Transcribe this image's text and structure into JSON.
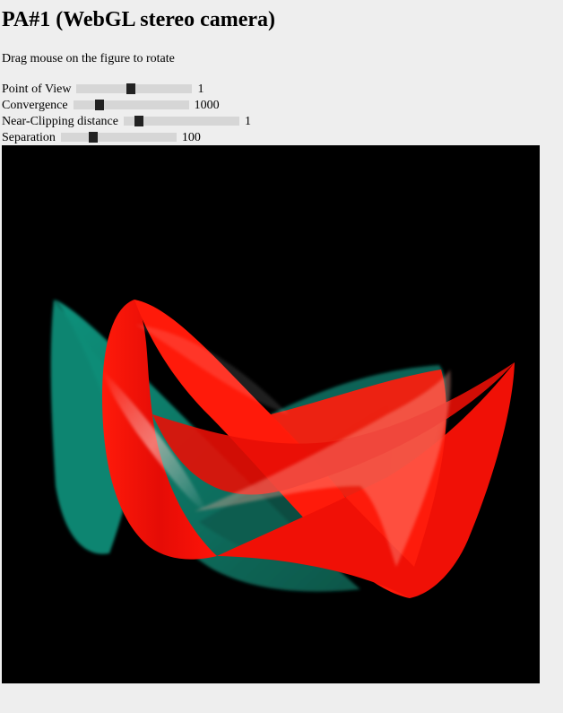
{
  "page": {
    "title": "PA#1 (WebGL stereo camera)",
    "instructions": "Drag mouse on the figure to rotate"
  },
  "controls": [
    {
      "label": "Point of View",
      "value": "1",
      "level_fraction": 0.47
    },
    {
      "label": "Convergence",
      "value": "1000",
      "level_fraction": 0.2
    },
    {
      "label": "Near-Clipping distance",
      "value": "1",
      "level_fraction": 0.1
    },
    {
      "label": "Separation",
      "value": "100",
      "level_fraction": 0.26
    }
  ],
  "viewer": {
    "background": "#000000",
    "left_eye_color": "#0f9a83",
    "right_eye_color": "#ff1a0a"
  }
}
